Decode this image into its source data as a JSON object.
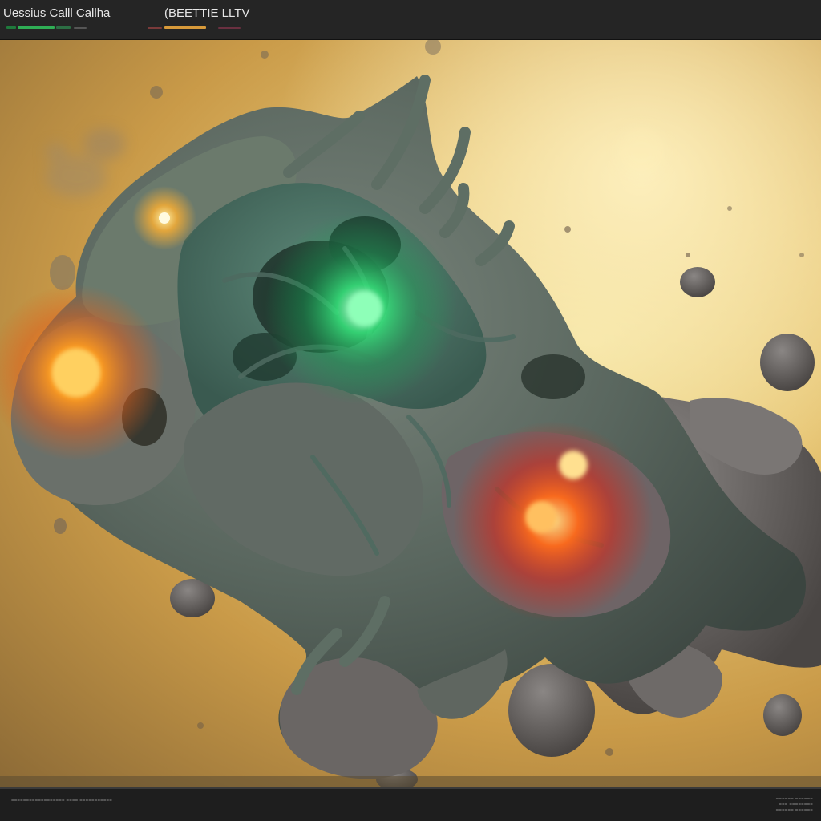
{
  "header": {
    "tabs": [
      {
        "label": "Uessius Calll Callha",
        "accent": "#2fae55"
      },
      {
        "label": "(BEETTIE LLTV",
        "accent": "#d89a3a"
      }
    ]
  },
  "viewport": {
    "scene": "cell-render",
    "colors": {
      "background": "#e6c472",
      "membrane": "#5f6f66",
      "glow_green": "#36e07a",
      "glow_orange": "#ff9a1e",
      "glow_red": "#ff4a1a"
    }
  },
  "status": {
    "left_text": "================== ==== ===========",
    "right_lines": [
      "====== ======",
      "=== ========",
      "====== ======"
    ]
  }
}
